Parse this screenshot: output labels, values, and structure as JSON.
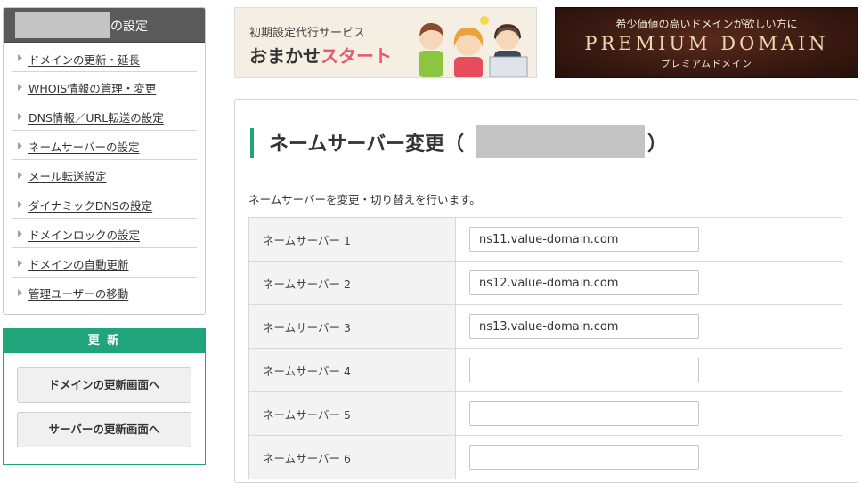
{
  "sidebar": {
    "title": "の設定",
    "items": [
      {
        "label": "ドメインの更新・延長"
      },
      {
        "label": "WHOIS情報の管理・変更"
      },
      {
        "label": "DNS情報／URL転送の設定"
      },
      {
        "label": "ネームサーバーの設定"
      },
      {
        "label": "メール転送設定"
      },
      {
        "label": "ダイナミックDNSの設定"
      },
      {
        "label": "ドメインロックの設定"
      },
      {
        "label": "ドメインの自動更新"
      },
      {
        "label": "管理ユーザーの移動"
      }
    ]
  },
  "renew": {
    "title": "更 新",
    "domain_button": "ドメインの更新画面へ",
    "server_button": "サーバーの更新画面へ"
  },
  "banners": {
    "omakase": {
      "sub": "初期設定代行サービス",
      "main_a": "おまかせ",
      "main_b": "スタート"
    },
    "premium": {
      "top": "希少価値の高いドメインが欲しい方に",
      "title": "PREMIUM DOMAIN",
      "sub": "プレミアムドメイン"
    }
  },
  "main": {
    "heading": "ネームサーバー変更（",
    "heading_close": "）",
    "description": "ネームサーバーを変更・切り替えを行います。",
    "nameservers": [
      {
        "label": "ネームサーバー 1",
        "value": "ns11.value-domain.com"
      },
      {
        "label": "ネームサーバー 2",
        "value": "ns12.value-domain.com"
      },
      {
        "label": "ネームサーバー 3",
        "value": "ns13.value-domain.com"
      },
      {
        "label": "ネームサーバー 4",
        "value": ""
      },
      {
        "label": "ネームサーバー 5",
        "value": ""
      },
      {
        "label": "ネームサーバー 6",
        "value": ""
      }
    ]
  },
  "colors": {
    "accent": "#20a57a",
    "sidebar_header": "#5a5a5a"
  }
}
